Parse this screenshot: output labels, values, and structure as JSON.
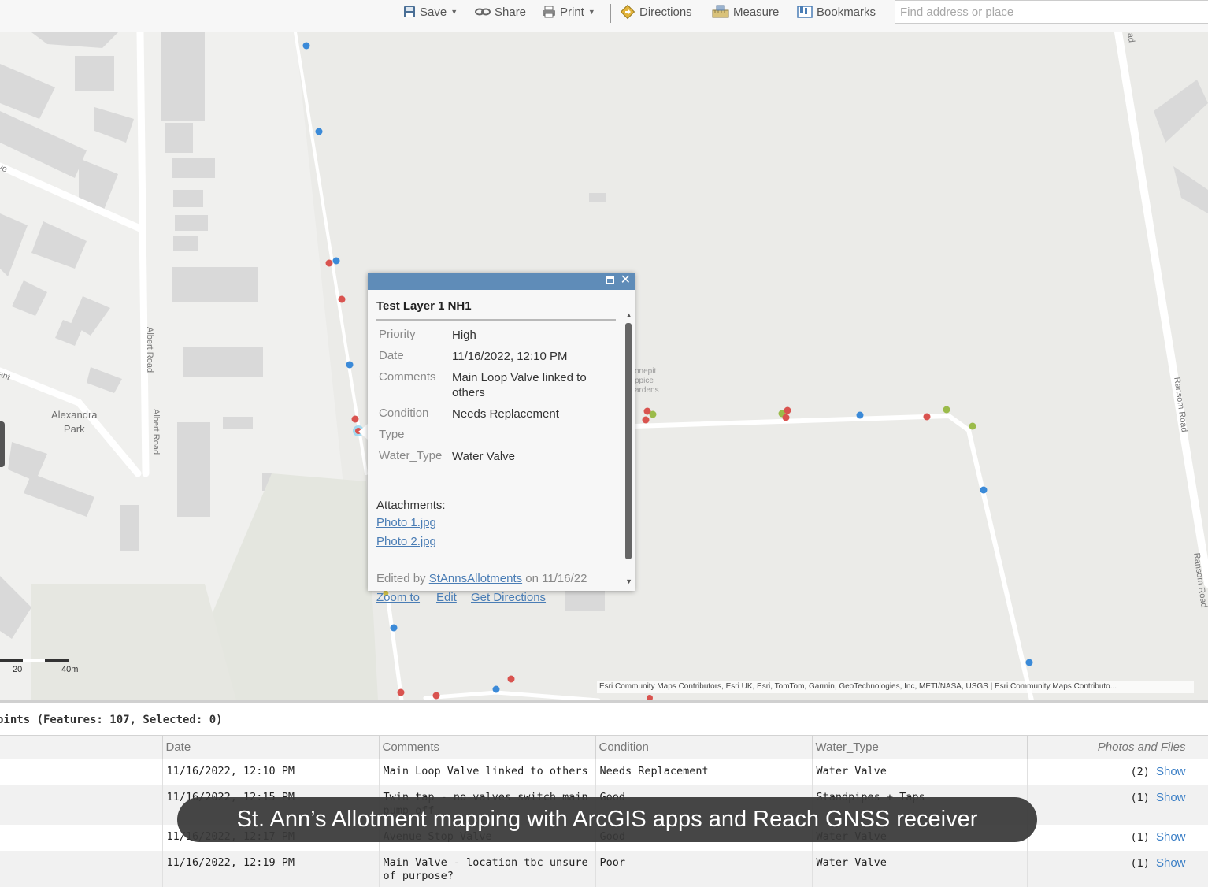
{
  "toolbar": {
    "save_label": "Save",
    "share_label": "Share",
    "print_label": "Print",
    "directions_label": "Directions",
    "measure_label": "Measure",
    "bookmarks_label": "Bookmarks",
    "search_placeholder": "Find address or place"
  },
  "map": {
    "labels": {
      "park": "Alexandra\nPark",
      "albert_road_1": "Albert Road",
      "albert_road_2": "Albert Road",
      "ransom_road_1": "Ransom Road",
      "ransom_road_2": "Ransom Road",
      "gardens": "onepit\nppice\nardens",
      "ave_fragment": "ve",
      "ent_fragment": "ent",
      "corner_fragment": "ad"
    },
    "scale": {
      "label_20": "20",
      "label_40": "40m"
    },
    "attribution": "Esri Community Maps Contributors, Esri UK, Esri, TomTom, Garmin, GeoTechnologies, Inc, METI/NASA, USGS | Esri Community Maps Contributo...",
    "point_colors": {
      "blue": "#3b8ad8",
      "red": "#d9534f",
      "green": "#9bbb4a"
    }
  },
  "popup": {
    "title": "Test Layer 1 NH1",
    "fields": [
      {
        "label": "Priority",
        "value": "High"
      },
      {
        "label": "Date",
        "value": "11/16/2022, 12:10 PM"
      },
      {
        "label": "Comments",
        "value": "Main Loop Valve linked to others"
      },
      {
        "label": "Condition",
        "value": "Needs Replacement"
      },
      {
        "label": "Type",
        "value": ""
      },
      {
        "label": "Water_Type",
        "value": "Water Valve"
      }
    ],
    "attachments_label": "Attachments:",
    "attachments": [
      "Photo 1.jpg",
      "Photo 2.jpg"
    ],
    "edited_prefix": "Edited by",
    "edited_by": "StAnnsAllotments",
    "edited_suffix": "on 11/16/22",
    "actions": {
      "zoom_to": "Zoom to",
      "edit": "Edit",
      "get_directions": "Get Directions"
    },
    "header_color": "#5f8cb8"
  },
  "table": {
    "title": "oints (Features: 107, Selected: 0)",
    "columns": [
      "",
      "Date",
      "Comments",
      "Condition",
      "Water_Type",
      "Photos and Files"
    ],
    "rows": [
      {
        "date": "11/16/2022, 12:10 PM",
        "comments": "Main Loop Valve linked to others",
        "condition": "Needs Replacement",
        "water_type": "Water Valve",
        "photos_count": "(2)",
        "show": "Show"
      },
      {
        "date": "11/16/2022, 12:15 PM",
        "comments": "Twin tap - no valves switch main pump off",
        "condition": "Good",
        "water_type": "Standpipes + Taps",
        "photos_count": "(1)",
        "show": "Show"
      },
      {
        "date": "11/16/2022, 12:17 PM",
        "comments": "Avenue Stop Valve",
        "condition": "Good",
        "water_type": "Water Valve",
        "photos_count": "(1)",
        "show": "Show"
      },
      {
        "date": "11/16/2022, 12:19 PM",
        "comments": "Main Valve - location tbc unsure of purpose?",
        "condition": "Poor",
        "water_type": "Water Valve",
        "photos_count": "(1)",
        "show": "Show"
      }
    ]
  },
  "caption": "St. Ann’s Allotment mapping with ArcGIS apps and Reach GNSS receiver"
}
